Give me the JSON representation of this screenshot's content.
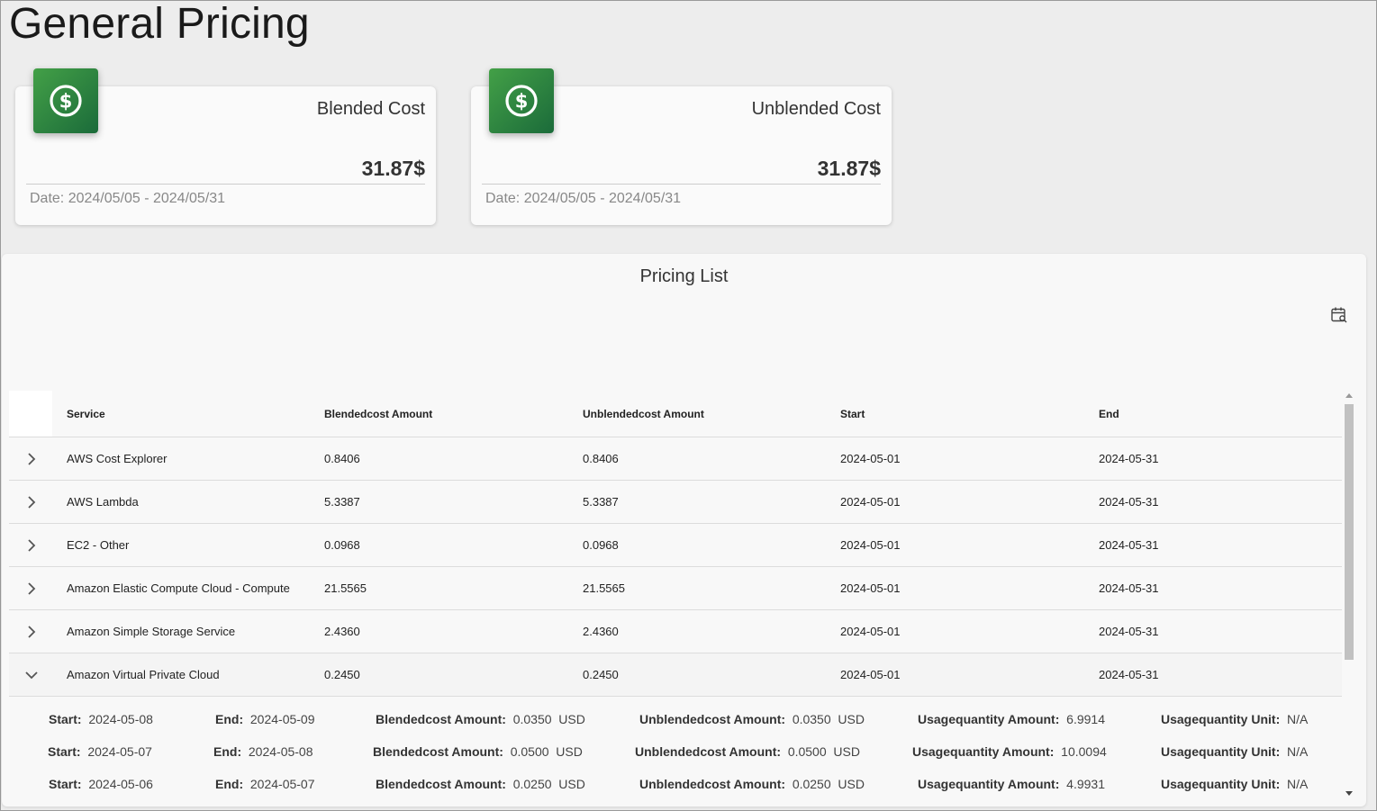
{
  "page": {
    "title": "General Pricing"
  },
  "cards": [
    {
      "label": "Blended Cost",
      "value": "31.87$",
      "date": "Date: 2024/05/05 - 2024/05/31",
      "icon": "dollar-circle-icon"
    },
    {
      "label": "Unblended Cost",
      "value": "31.87$",
      "date": "Date: 2024/05/05 - 2024/05/31",
      "icon": "dollar-circle-icon"
    }
  ],
  "pricing_list": {
    "title": "Pricing List",
    "columns": [
      "Service",
      "Blendedcost Amount",
      "Unblendedcost Amount",
      "Start",
      "End"
    ],
    "rows": [
      {
        "service": "AWS Cost Explorer",
        "blended": "0.8406",
        "unblended": "0.8406",
        "start": "2024-05-01",
        "end": "2024-05-31"
      },
      {
        "service": "AWS Lambda",
        "blended": "5.3387",
        "unblended": "5.3387",
        "start": "2024-05-01",
        "end": "2024-05-31"
      },
      {
        "service": "EC2 - Other",
        "blended": "0.0968",
        "unblended": "0.0968",
        "start": "2024-05-01",
        "end": "2024-05-31"
      },
      {
        "service": "Amazon Elastic Compute Cloud - Compute",
        "blended": "21.5565",
        "unblended": "21.5565",
        "start": "2024-05-01",
        "end": "2024-05-31"
      },
      {
        "service": "Amazon Simple Storage Service",
        "blended": "2.4360",
        "unblended": "2.4360",
        "start": "2024-05-01",
        "end": "2024-05-31"
      },
      {
        "service": "Amazon Virtual Private Cloud",
        "blended": "0.2450",
        "unblended": "0.2450",
        "start": "2024-05-01",
        "end": "2024-05-31"
      }
    ],
    "detail_labels": {
      "start": "Start:",
      "end": "End:",
      "blended": "Blendedcost Amount:",
      "unblended": "Unblendedcost Amount:",
      "usage_amount": "Usagequantity Amount:",
      "usage_unit": "Usagequantity Unit:"
    },
    "details": [
      {
        "start": "2024-05-08",
        "end": "2024-05-09",
        "blended": "0.0350  USD",
        "unblended": "0.0350  USD",
        "usage_amount": "6.9914",
        "usage_unit": "N/A"
      },
      {
        "start": "2024-05-07",
        "end": "2024-05-08",
        "blended": "0.0500  USD",
        "unblended": "0.0500  USD",
        "usage_amount": "10.0094",
        "usage_unit": "N/A"
      },
      {
        "start": "2024-05-06",
        "end": "2024-05-07",
        "blended": "0.0250  USD",
        "unblended": "0.0250  USD",
        "usage_amount": "4.9931",
        "usage_unit": "N/A"
      }
    ]
  },
  "colors": {
    "card_icon_green": "#2e8b4a",
    "background": "#ededed"
  }
}
